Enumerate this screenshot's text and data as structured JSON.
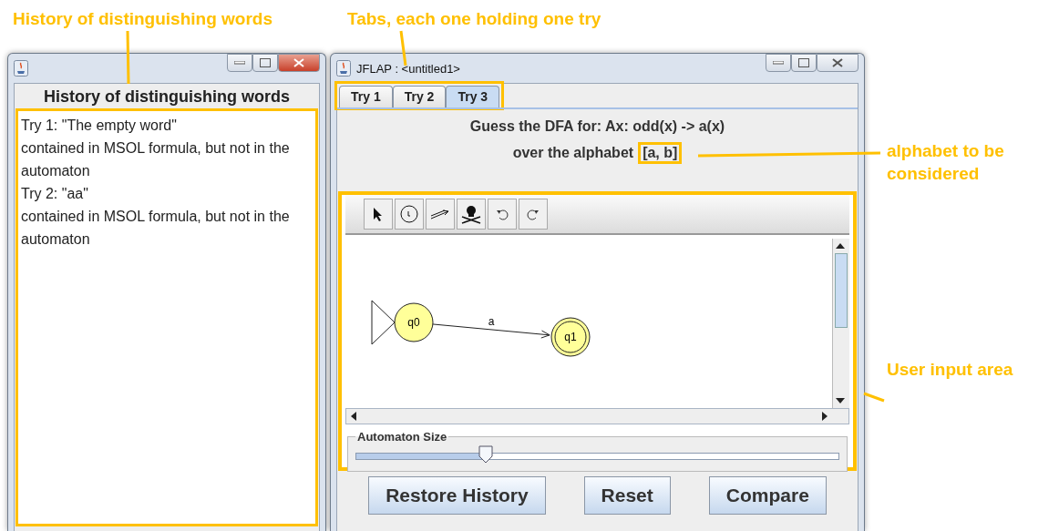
{
  "annotations": [
    {
      "text": "History of distinguishing words"
    },
    {
      "text": "Tabs, each one holding one try"
    },
    {
      "text": "alphabet to be considered"
    },
    {
      "text": "User input area"
    }
  ],
  "history_window": {
    "heading": "History of distinguishing words",
    "lines": [
      "Try 1: \"The empty word\"",
      "contained in MSOL formula, but not in the automaton",
      "Try 2: \"aa\"",
      "contained in MSOL formula, but not in the automaton"
    ]
  },
  "main_window": {
    "title": "JFLAP : <untitled1>",
    "tabs": [
      {
        "label": "Try 1",
        "selected": false
      },
      {
        "label": "Try 2",
        "selected": false
      },
      {
        "label": "Try 3",
        "selected": true
      }
    ],
    "question": {
      "line_1": "Guess the DFA for: Ax: odd(x) -> a(x)",
      "line_2": "over the alphabet",
      "alphabet": "[a, b]"
    },
    "tools": [
      {
        "kind": "select",
        "selected": false
      },
      {
        "kind": "state",
        "selected": false
      },
      {
        "kind": "transition",
        "selected": false
      },
      {
        "kind": "delete",
        "selected": false
      },
      {
        "kind": "undo",
        "selected": false
      },
      {
        "kind": "redo",
        "selected": false
      }
    ],
    "automaton": {
      "states": [
        {
          "name": "q0",
          "initial": true,
          "final": false
        },
        {
          "name": "q1",
          "initial": false,
          "final": true
        }
      ],
      "transitions": [
        {
          "label": "a"
        }
      ]
    },
    "size_slider": {
      "label": "Automaton Size",
      "level": 0.27
    },
    "buttons": [
      "Restore History",
      "Reset",
      "Compare"
    ]
  }
}
